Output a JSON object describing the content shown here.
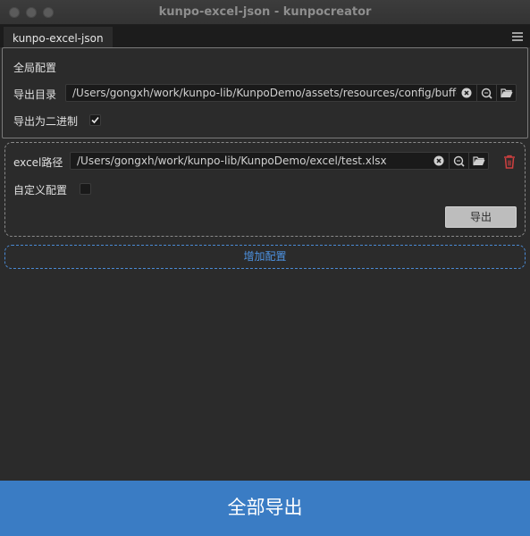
{
  "window": {
    "title": "kunpo-excel-json - kunpocreator"
  },
  "tab": {
    "label": "kunpo-excel-json"
  },
  "global_config": {
    "title": "全局配置",
    "export_dir_label": "导出目录",
    "export_dir_value": "/Users/gongxh/work/kunpo-lib/KunpoDemo/assets/resources/config/buffer",
    "binary_label": "导出为二进制",
    "binary_checked": true
  },
  "items": [
    {
      "excel_path_label": "excel路径",
      "excel_path_value": "/Users/gongxh/work/kunpo-lib/KunpoDemo/excel/test.xlsx",
      "custom_config_label": "自定义配置",
      "custom_config_checked": false,
      "export_label": "导出"
    }
  ],
  "add_config_label": "增加配置",
  "export_all_label": "全部导出",
  "icons": [
    "clear-icon",
    "search-icon",
    "folder-open-icon",
    "trash-icon",
    "hamburger-menu-icon",
    "checkmark-icon"
  ],
  "colors": {
    "primary": "#3a7cc4",
    "link": "#4d93e3",
    "danger": "#d04040"
  }
}
